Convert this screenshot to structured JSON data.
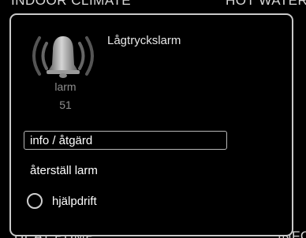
{
  "background": {
    "top_left_label": "INDOOR CLIMATE",
    "top_right_label": "HOT WATER",
    "bottom_left_label": "HEAT PUMP",
    "bottom_right_label": "INFO"
  },
  "dialog": {
    "title": "Lågtryckslarm",
    "alarm_icon": "alarm-bell-icon",
    "alarm_label": "larm",
    "alarm_number": "51",
    "menu": {
      "info_label": "info / åtgärd",
      "reset_label": "återställ larm",
      "help_label": "hjälpdrift",
      "help_checked": false
    }
  },
  "colors": {
    "background": "#000000",
    "dialog_border": "#c9c9c9",
    "text": "#ffffff",
    "muted_text": "#8e8e8e"
  }
}
